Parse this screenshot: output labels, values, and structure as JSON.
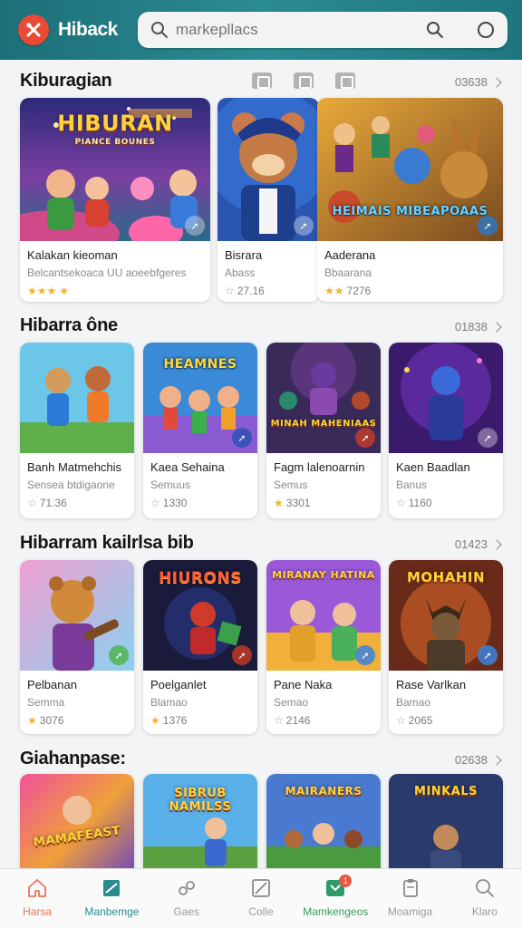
{
  "header": {
    "logo_icon": "wrench-cross-icon",
    "app_name": "Hiback",
    "search_placeholder": "markepllacs",
    "search_icon": "search-icon",
    "right_icons": [
      "search-icon",
      "circle-icon"
    ]
  },
  "sections": [
    {
      "title": "Kiburagian",
      "count": "03638",
      "filters": [
        "filter-icon",
        "filter-icon",
        "filter-icon"
      ],
      "cards": [
        {
          "name": "Kalakan kieoman",
          "sub": "Belcantsekoaca UU aoeebfgeres",
          "rating": "",
          "stars": 3,
          "thumb_title": "HIBURAN",
          "thumb_sub": "PIANCE BOUNES"
        },
        {
          "name": "Bisrara",
          "sub": "Abass",
          "rating": "27.16",
          "stars": 1,
          "thumb_title": "",
          "thumb_sub": ""
        },
        {
          "name": "Aaderana",
          "sub": "Bbaarana",
          "rating": "7276",
          "stars": 2,
          "thumb_title": "HEIMAIS MIBEAPOAAS",
          "thumb_sub": ""
        }
      ]
    },
    {
      "title": "Hibarra ône",
      "count": "01838",
      "cards": [
        {
          "name": "Banh Matmehchis",
          "sub": "Sensea btdigaone",
          "rating": "71.36",
          "stars": 1,
          "thumb_title": "",
          "thumb_sub": ""
        },
        {
          "name": "Kaea Sehaina",
          "sub": "Semuus",
          "rating": "1330",
          "stars": 1,
          "thumb_title": "HEAMNES",
          "thumb_sub": ""
        },
        {
          "name": "Fagm lalenoarnin",
          "sub": "Semus",
          "rating": "3301",
          "stars": 1,
          "thumb_title": "MINAH MAHENIAAS",
          "thumb_sub": ""
        },
        {
          "name": "Kaen Baadlan",
          "sub": "Banus",
          "rating": "1160",
          "stars": 1,
          "thumb_title": "",
          "thumb_sub": ""
        }
      ]
    },
    {
      "title": "Hibarram kailrlsa bib",
      "count": "01423",
      "cards": [
        {
          "name": "Pelbanan",
          "sub": "Semma",
          "rating": "3076",
          "stars": 1,
          "thumb_title": "",
          "thumb_sub": ""
        },
        {
          "name": "Poelganlet",
          "sub": "Blamao",
          "rating": "1376",
          "stars": 1,
          "thumb_title": "HIURONS",
          "thumb_sub": ""
        },
        {
          "name": "Pane Naka",
          "sub": "Semao",
          "rating": "2146",
          "stars": 1,
          "thumb_title": "MIRANAY HATINA",
          "thumb_sub": ""
        },
        {
          "name": "Rase Varlkan",
          "sub": "Bamao",
          "rating": "2065",
          "stars": 1,
          "thumb_title": "MOHAHIN",
          "thumb_sub": ""
        }
      ]
    },
    {
      "title": "Giahanpase:",
      "count": "02638",
      "cards": [
        {
          "thumb_title": "MAMAFEAST"
        },
        {
          "thumb_title": "SIBRUB NAMILSS"
        },
        {
          "thumb_title": "MAIRANERS"
        },
        {
          "thumb_title": "MINKALS"
        }
      ]
    }
  ],
  "nav": [
    {
      "label": "Harsa",
      "icon": "home-icon"
    },
    {
      "label": "Manbemge",
      "icon": "market-icon"
    },
    {
      "label": "Gaes",
      "icon": "link-icon"
    },
    {
      "label": "Colle",
      "icon": "collection-icon"
    },
    {
      "label": "Mamkengeos",
      "icon": "shop-icon",
      "badge": "1"
    },
    {
      "label": "Moamiga",
      "icon": "clipboard-icon"
    },
    {
      "label": "Klaro",
      "icon": "search-icon"
    }
  ],
  "colors": {
    "header": "#1f7680",
    "accent": "#2a8c8f",
    "logo": "#ea4a35",
    "star": "#f2b135"
  }
}
